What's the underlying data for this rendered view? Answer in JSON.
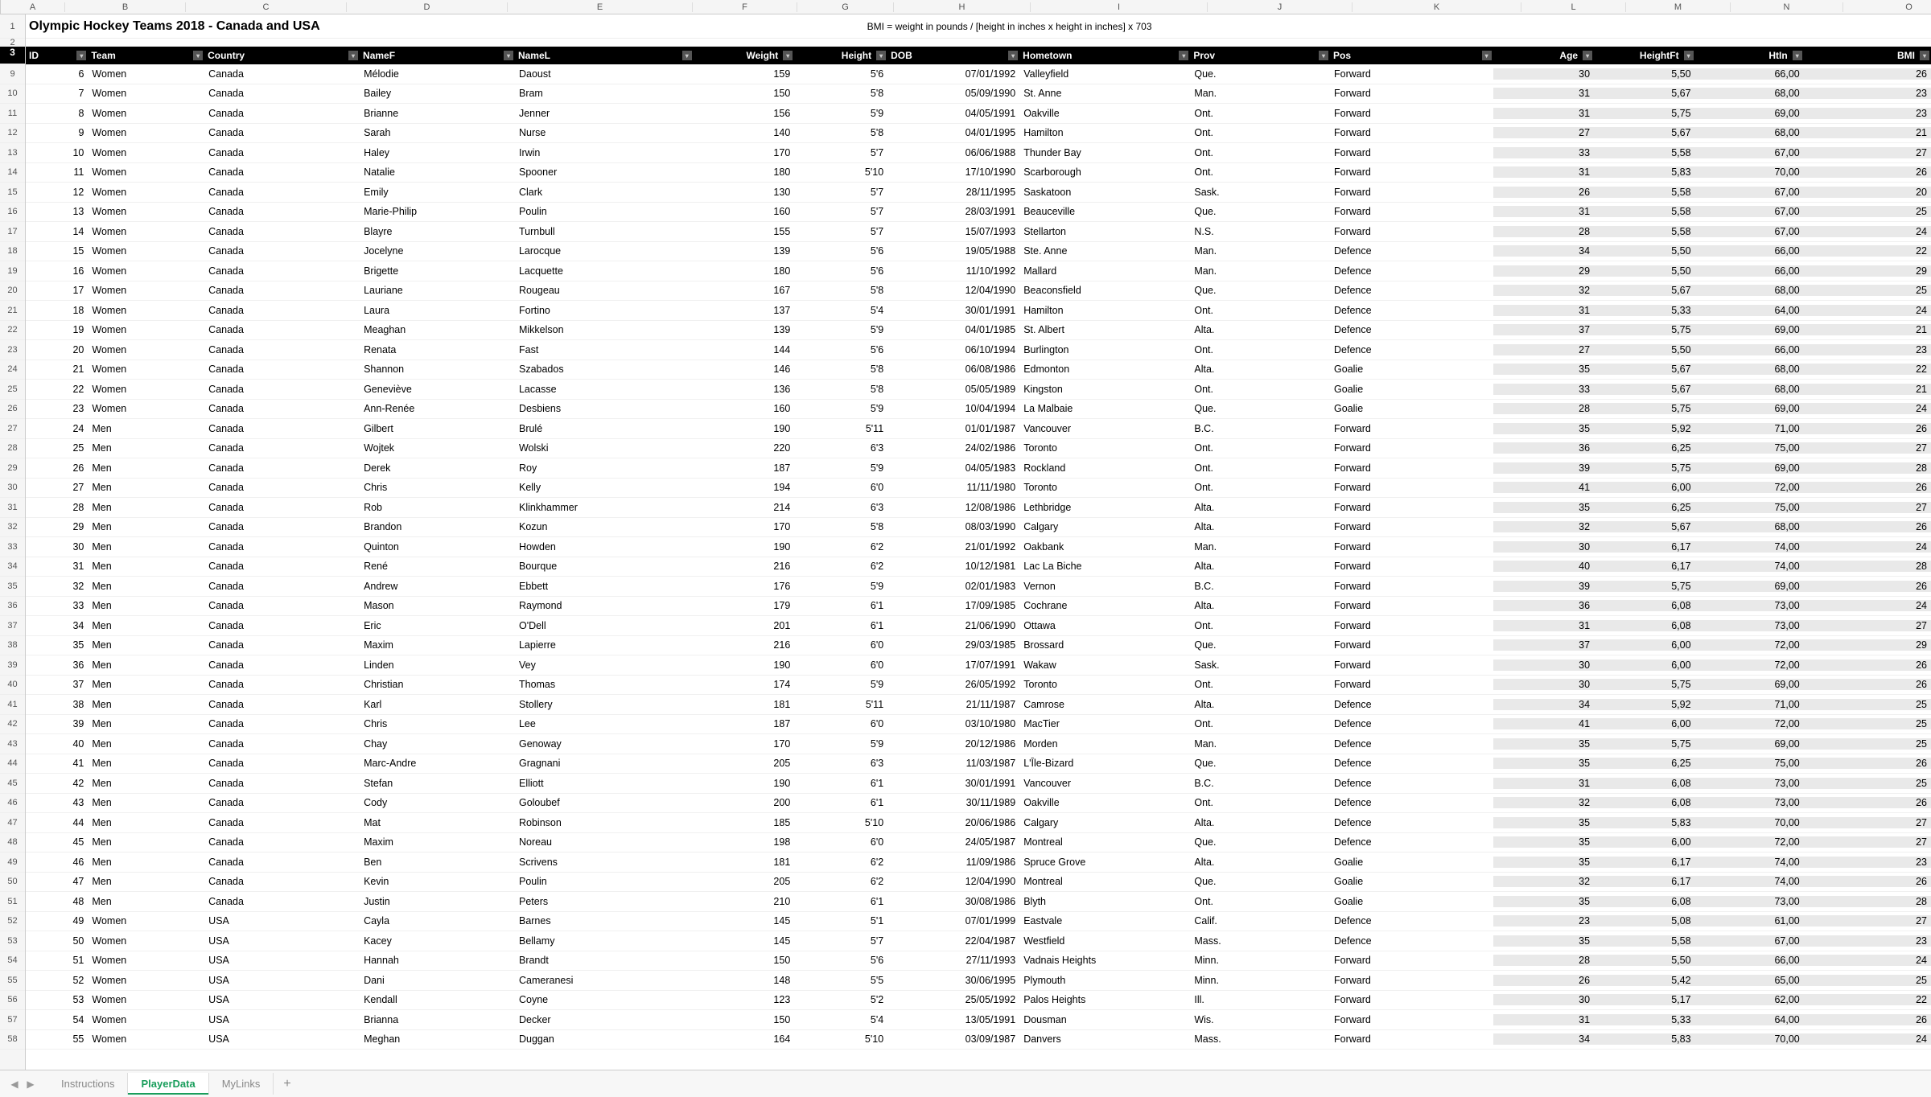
{
  "title": "Olympic Hockey Teams 2018 - Canada and USA",
  "subtitle": "BMI = weight in pounds / [height in inches x height in inches] x 703",
  "columns": [
    "A",
    "B",
    "C",
    "D",
    "E",
    "F",
    "G",
    "H",
    "I",
    "J",
    "K",
    "L",
    "M",
    "N",
    "O"
  ],
  "widths": [
    80,
    150,
    200,
    200,
    230,
    130,
    120,
    170,
    220,
    180,
    210,
    130,
    130,
    140,
    164
  ],
  "row_labels": [
    "1",
    "2",
    "3",
    "9",
    "10",
    "11",
    "12",
    "13",
    "14",
    "15",
    "16",
    "17",
    "18",
    "19",
    "20",
    "21",
    "22",
    "23",
    "24",
    "25",
    "26",
    "27",
    "28",
    "29",
    "30",
    "31",
    "32",
    "33",
    "34",
    "35",
    "36",
    "37",
    "38",
    "39",
    "40",
    "41",
    "42",
    "43",
    "44",
    "45",
    "46",
    "47",
    "48",
    "49",
    "50",
    "51",
    "52",
    "53",
    "54",
    "55",
    "56",
    "57",
    "58"
  ],
  "headers": [
    "ID",
    "Team",
    "Country",
    "NameF",
    "NameL",
    "Weight",
    "Height",
    "DOB",
    "Hometown",
    "Prov",
    "Pos",
    "Age",
    "HeightFt",
    "HtIn",
    "BMI"
  ],
  "header_filter": [
    true,
    true,
    true,
    true,
    true,
    true,
    true,
    true,
    true,
    true,
    true,
    true,
    true,
    true,
    true
  ],
  "header_align": [
    "l",
    "l",
    "l",
    "l",
    "l",
    "r",
    "r",
    "l",
    "l",
    "l",
    "l",
    "r",
    "r",
    "r",
    "r"
  ],
  "calc_cols": [
    11,
    12,
    13,
    14
  ],
  "tabs": [
    "Instructions",
    "PlayerData",
    "MyLinks"
  ],
  "active_tab": 1,
  "rows": [
    [
      6,
      "Women",
      "Canada",
      "Mélodie",
      "Daoust",
      159,
      "5'6",
      "07/01/1992",
      "Valleyfield",
      "Que.",
      "Forward",
      30,
      "5,50",
      "66,00",
      26
    ],
    [
      7,
      "Women",
      "Canada",
      "Bailey",
      "Bram",
      150,
      "5'8",
      "05/09/1990",
      "St. Anne",
      "Man.",
      "Forward",
      31,
      "5,67",
      "68,00",
      23
    ],
    [
      8,
      "Women",
      "Canada",
      "Brianne",
      "Jenner",
      156,
      "5'9",
      "04/05/1991",
      "Oakville",
      "Ont.",
      "Forward",
      31,
      "5,75",
      "69,00",
      23
    ],
    [
      9,
      "Women",
      "Canada",
      "Sarah",
      "Nurse",
      140,
      "5'8",
      "04/01/1995",
      "Hamilton",
      "Ont.",
      "Forward",
      27,
      "5,67",
      "68,00",
      21
    ],
    [
      10,
      "Women",
      "Canada",
      "Haley",
      "Irwin",
      170,
      "5'7",
      "06/06/1988",
      "Thunder Bay",
      "Ont.",
      "Forward",
      33,
      "5,58",
      "67,00",
      27
    ],
    [
      11,
      "Women",
      "Canada",
      "Natalie",
      "Spooner",
      180,
      "5'10",
      "17/10/1990",
      "Scarborough",
      "Ont.",
      "Forward",
      31,
      "5,83",
      "70,00",
      26
    ],
    [
      12,
      "Women",
      "Canada",
      "Emily",
      "Clark",
      130,
      "5'7",
      "28/11/1995",
      "Saskatoon",
      "Sask.",
      "Forward",
      26,
      "5,58",
      "67,00",
      20
    ],
    [
      13,
      "Women",
      "Canada",
      "Marie-Philip",
      "Poulin",
      160,
      "5'7",
      "28/03/1991",
      "Beauceville",
      "Que.",
      "Forward",
      31,
      "5,58",
      "67,00",
      25
    ],
    [
      14,
      "Women",
      "Canada",
      "Blayre",
      "Turnbull",
      155,
      "5'7",
      "15/07/1993",
      "Stellarton",
      "N.S.",
      "Forward",
      28,
      "5,58",
      "67,00",
      24
    ],
    [
      15,
      "Women",
      "Canada",
      "Jocelyne",
      "Larocque",
      139,
      "5'6",
      "19/05/1988",
      "Ste. Anne",
      "Man.",
      "Defence",
      34,
      "5,50",
      "66,00",
      22
    ],
    [
      16,
      "Women",
      "Canada",
      "Brigette",
      "Lacquette",
      180,
      "5'6",
      "11/10/1992",
      "Mallard",
      "Man.",
      "Defence",
      29,
      "5,50",
      "66,00",
      29
    ],
    [
      17,
      "Women",
      "Canada",
      "Lauriane",
      "Rougeau",
      167,
      "5'8",
      "12/04/1990",
      "Beaconsfield",
      "Que.",
      "Defence",
      32,
      "5,67",
      "68,00",
      25
    ],
    [
      18,
      "Women",
      "Canada",
      "Laura",
      "Fortino",
      137,
      "5'4",
      "30/01/1991",
      "Hamilton",
      "Ont.",
      "Defence",
      31,
      "5,33",
      "64,00",
      24
    ],
    [
      19,
      "Women",
      "Canada",
      "Meaghan",
      "Mikkelson",
      139,
      "5'9",
      "04/01/1985",
      "St. Albert",
      "Alta.",
      "Defence",
      37,
      "5,75",
      "69,00",
      21
    ],
    [
      20,
      "Women",
      "Canada",
      "Renata",
      "Fast",
      144,
      "5'6",
      "06/10/1994",
      "Burlington",
      "Ont.",
      "Defence",
      27,
      "5,50",
      "66,00",
      23
    ],
    [
      21,
      "Women",
      "Canada",
      "Shannon",
      "Szabados",
      146,
      "5'8",
      "06/08/1986",
      "Edmonton",
      "Alta.",
      "Goalie",
      35,
      "5,67",
      "68,00",
      22
    ],
    [
      22,
      "Women",
      "Canada",
      "Geneviève",
      "Lacasse",
      136,
      "5'8",
      "05/05/1989",
      "Kingston",
      "Ont.",
      "Goalie",
      33,
      "5,67",
      "68,00",
      21
    ],
    [
      23,
      "Women",
      "Canada",
      "Ann-Renée",
      "Desbiens",
      160,
      "5'9",
      "10/04/1994",
      "La Malbaie",
      "Que.",
      "Goalie",
      28,
      "5,75",
      "69,00",
      24
    ],
    [
      24,
      "Men",
      "Canada",
      "Gilbert",
      "Brulé",
      190,
      "5'11",
      "01/01/1987",
      "Vancouver",
      "B.C.",
      "Forward",
      35,
      "5,92",
      "71,00",
      26
    ],
    [
      25,
      "Men",
      "Canada",
      "Wojtek",
      "Wolski",
      220,
      "6'3",
      "24/02/1986",
      "Toronto",
      "Ont.",
      "Forward",
      36,
      "6,25",
      "75,00",
      27
    ],
    [
      26,
      "Men",
      "Canada",
      "Derek",
      "Roy",
      187,
      "5'9",
      "04/05/1983",
      "Rockland",
      "Ont.",
      "Forward",
      39,
      "5,75",
      "69,00",
      28
    ],
    [
      27,
      "Men",
      "Canada",
      "Chris",
      "Kelly",
      194,
      "6'0",
      "11/11/1980",
      "Toronto",
      "Ont.",
      "Forward",
      41,
      "6,00",
      "72,00",
      26
    ],
    [
      28,
      "Men",
      "Canada",
      "Rob",
      "Klinkhammer",
      214,
      "6'3",
      "12/08/1986",
      "Lethbridge",
      "Alta.",
      "Forward",
      35,
      "6,25",
      "75,00",
      27
    ],
    [
      29,
      "Men",
      "Canada",
      "Brandon",
      "Kozun",
      170,
      "5'8",
      "08/03/1990",
      "Calgary",
      "Alta.",
      "Forward",
      32,
      "5,67",
      "68,00",
      26
    ],
    [
      30,
      "Men",
      "Canada",
      "Quinton",
      "Howden",
      190,
      "6'2",
      "21/01/1992",
      "Oakbank",
      "Man.",
      "Forward",
      30,
      "6,17",
      "74,00",
      24
    ],
    [
      31,
      "Men",
      "Canada",
      "René",
      "Bourque",
      216,
      "6'2",
      "10/12/1981",
      "Lac La Biche",
      "Alta.",
      "Forward",
      40,
      "6,17",
      "74,00",
      28
    ],
    [
      32,
      "Men",
      "Canada",
      "Andrew",
      "Ebbett",
      176,
      "5'9",
      "02/01/1983",
      "Vernon",
      "B.C.",
      "Forward",
      39,
      "5,75",
      "69,00",
      26
    ],
    [
      33,
      "Men",
      "Canada",
      "Mason",
      "Raymond",
      179,
      "6'1",
      "17/09/1985",
      "Cochrane",
      "Alta.",
      "Forward",
      36,
      "6,08",
      "73,00",
      24
    ],
    [
      34,
      "Men",
      "Canada",
      "Eric",
      "O'Dell",
      201,
      "6'1",
      "21/06/1990",
      "Ottawa",
      "Ont.",
      "Forward",
      31,
      "6,08",
      "73,00",
      27
    ],
    [
      35,
      "Men",
      "Canada",
      "Maxim",
      "Lapierre",
      216,
      "6'0",
      "29/03/1985",
      "Brossard",
      "Que.",
      "Forward",
      37,
      "6,00",
      "72,00",
      29
    ],
    [
      36,
      "Men",
      "Canada",
      "Linden",
      "Vey",
      190,
      "6'0",
      "17/07/1991",
      "Wakaw",
      "Sask.",
      "Forward",
      30,
      "6,00",
      "72,00",
      26
    ],
    [
      37,
      "Men",
      "Canada",
      "Christian",
      "Thomas",
      174,
      "5'9",
      "26/05/1992",
      "Toronto",
      "Ont.",
      "Forward",
      30,
      "5,75",
      "69,00",
      26
    ],
    [
      38,
      "Men",
      "Canada",
      "Karl",
      "Stollery",
      181,
      "5'11",
      "21/11/1987",
      "Camrose",
      "Alta.",
      "Defence",
      34,
      "5,92",
      "71,00",
      25
    ],
    [
      39,
      "Men",
      "Canada",
      "Chris",
      "Lee",
      187,
      "6'0",
      "03/10/1980",
      "MacTier",
      "Ont.",
      "Defence",
      41,
      "6,00",
      "72,00",
      25
    ],
    [
      40,
      "Men",
      "Canada",
      "Chay",
      "Genoway",
      170,
      "5'9",
      "20/12/1986",
      "Morden",
      "Man.",
      "Defence",
      35,
      "5,75",
      "69,00",
      25
    ],
    [
      41,
      "Men",
      "Canada",
      "Marc-Andre",
      "Gragnani",
      205,
      "6'3",
      "11/03/1987",
      "L'Île-Bizard",
      "Que.",
      "Defence",
      35,
      "6,25",
      "75,00",
      26
    ],
    [
      42,
      "Men",
      "Canada",
      "Stefan",
      "Elliott",
      190,
      "6'1",
      "30/01/1991",
      "Vancouver",
      "B.C.",
      "Defence",
      31,
      "6,08",
      "73,00",
      25
    ],
    [
      43,
      "Men",
      "Canada",
      "Cody",
      "Goloubef",
      200,
      "6'1",
      "30/11/1989",
      "Oakville",
      "Ont.",
      "Defence",
      32,
      "6,08",
      "73,00",
      26
    ],
    [
      44,
      "Men",
      "Canada",
      "Mat",
      "Robinson",
      185,
      "5'10",
      "20/06/1986",
      "Calgary",
      "Alta.",
      "Defence",
      35,
      "5,83",
      "70,00",
      27
    ],
    [
      45,
      "Men",
      "Canada",
      "Maxim",
      "Noreau",
      198,
      "6'0",
      "24/05/1987",
      "Montreal",
      "Que.",
      "Defence",
      35,
      "6,00",
      "72,00",
      27
    ],
    [
      46,
      "Men",
      "Canada",
      "Ben",
      "Scrivens",
      181,
      "6'2",
      "11/09/1986",
      "Spruce Grove",
      "Alta.",
      "Goalie",
      35,
      "6,17",
      "74,00",
      23
    ],
    [
      47,
      "Men",
      "Canada",
      "Kevin",
      "Poulin",
      205,
      "6'2",
      "12/04/1990",
      "Montreal",
      "Que.",
      "Goalie",
      32,
      "6,17",
      "74,00",
      26
    ],
    [
      48,
      "Men",
      "Canada",
      "Justin",
      "Peters",
      210,
      "6'1",
      "30/08/1986",
      "Blyth",
      "Ont.",
      "Goalie",
      35,
      "6,08",
      "73,00",
      28
    ],
    [
      49,
      "Women",
      "USA",
      "Cayla",
      "Barnes",
      145,
      "5'1",
      "07/01/1999",
      "Eastvale",
      "Calif.",
      "Defence",
      23,
      "5,08",
      "61,00",
      27
    ],
    [
      50,
      "Women",
      "USA",
      "Kacey",
      "Bellamy",
      145,
      "5'7",
      "22/04/1987",
      "Westfield",
      "Mass.",
      "Defence",
      35,
      "5,58",
      "67,00",
      23
    ],
    [
      51,
      "Women",
      "USA",
      "Hannah",
      "Brandt",
      150,
      "5'6",
      "27/11/1993",
      "Vadnais Heights",
      "Minn.",
      "Forward",
      28,
      "5,50",
      "66,00",
      24
    ],
    [
      52,
      "Women",
      "USA",
      "Dani",
      "Cameranesi",
      148,
      "5'5",
      "30/06/1995",
      "Plymouth",
      "Minn.",
      "Forward",
      26,
      "5,42",
      "65,00",
      25
    ],
    [
      53,
      "Women",
      "USA",
      "Kendall",
      "Coyne",
      123,
      "5'2",
      "25/05/1992",
      "Palos Heights",
      "Ill.",
      "Forward",
      30,
      "5,17",
      "62,00",
      22
    ],
    [
      54,
      "Women",
      "USA",
      "Brianna",
      "Decker",
      150,
      "5'4",
      "13/05/1991",
      "Dousman",
      "Wis.",
      "Forward",
      31,
      "5,33",
      "64,00",
      26
    ],
    [
      55,
      "Women",
      "USA",
      "Meghan",
      "Duggan",
      164,
      "5'10",
      "03/09/1987",
      "Danvers",
      "Mass.",
      "Forward",
      34,
      "5,83",
      "70,00",
      24
    ]
  ]
}
